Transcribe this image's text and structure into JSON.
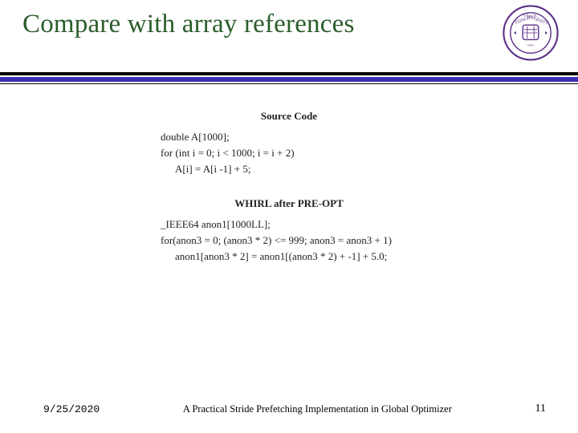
{
  "header": {
    "title": "Compare with array references",
    "logo_alt": "Tsinghua University seal"
  },
  "code": {
    "section1_title": "Source Code",
    "s1_line1": "double A[1000];",
    "s1_line2": "for (int i = 0; i < 1000; i = i + 2)",
    "s1_line3": "A[i] = A[i -1] + 5;",
    "section2_title": "WHIRL after PRE-OPT",
    "s2_line1": "_IEEE64 anon1[1000LL];",
    "s2_line2": "for(anon3 = 0; (anon3 * 2) <= 999; anon3 = anon3 + 1)",
    "s2_line3": "anon1[anon3 * 2] = anon1[(anon3 * 2) + -1] + 5.0;"
  },
  "footer": {
    "date": "9/25/2020",
    "title": "A Practical Stride Prefetching Implementation in Global Optimizer",
    "page": "11"
  }
}
